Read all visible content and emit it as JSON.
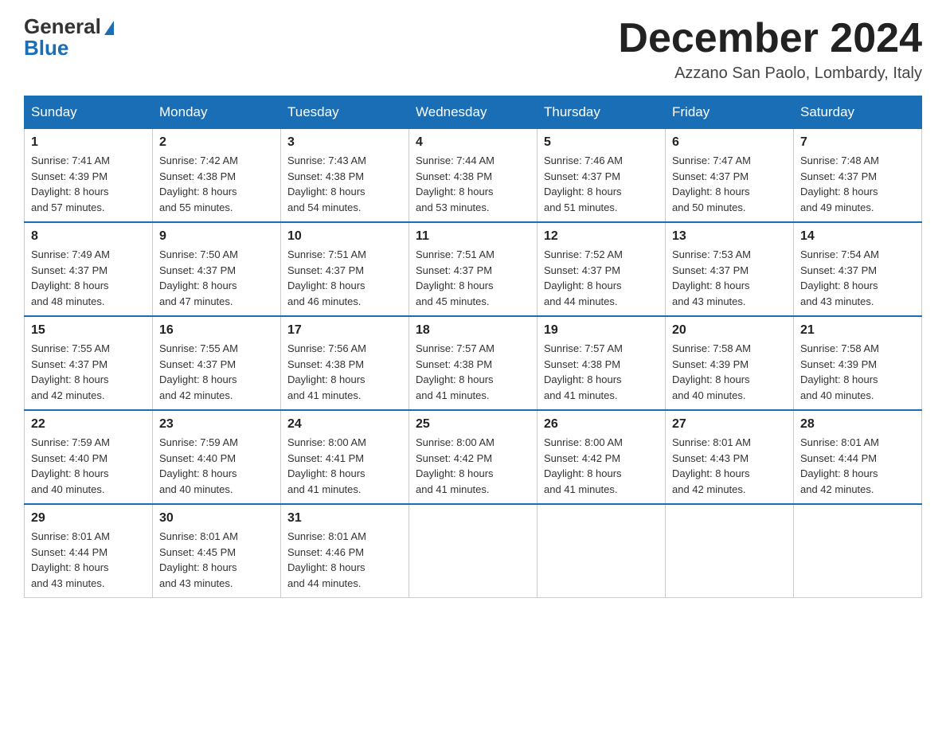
{
  "logo": {
    "general": "General",
    "blue": "Blue"
  },
  "title": "December 2024",
  "location": "Azzano San Paolo, Lombardy, Italy",
  "weekdays": [
    "Sunday",
    "Monday",
    "Tuesday",
    "Wednesday",
    "Thursday",
    "Friday",
    "Saturday"
  ],
  "weeks": [
    [
      {
        "day": "1",
        "sunrise": "7:41 AM",
        "sunset": "4:39 PM",
        "daylight": "8 hours and 57 minutes."
      },
      {
        "day": "2",
        "sunrise": "7:42 AM",
        "sunset": "4:38 PM",
        "daylight": "8 hours and 55 minutes."
      },
      {
        "day": "3",
        "sunrise": "7:43 AM",
        "sunset": "4:38 PM",
        "daylight": "8 hours and 54 minutes."
      },
      {
        "day": "4",
        "sunrise": "7:44 AM",
        "sunset": "4:38 PM",
        "daylight": "8 hours and 53 minutes."
      },
      {
        "day": "5",
        "sunrise": "7:46 AM",
        "sunset": "4:37 PM",
        "daylight": "8 hours and 51 minutes."
      },
      {
        "day": "6",
        "sunrise": "7:47 AM",
        "sunset": "4:37 PM",
        "daylight": "8 hours and 50 minutes."
      },
      {
        "day": "7",
        "sunrise": "7:48 AM",
        "sunset": "4:37 PM",
        "daylight": "8 hours and 49 minutes."
      }
    ],
    [
      {
        "day": "8",
        "sunrise": "7:49 AM",
        "sunset": "4:37 PM",
        "daylight": "8 hours and 48 minutes."
      },
      {
        "day": "9",
        "sunrise": "7:50 AM",
        "sunset": "4:37 PM",
        "daylight": "8 hours and 47 minutes."
      },
      {
        "day": "10",
        "sunrise": "7:51 AM",
        "sunset": "4:37 PM",
        "daylight": "8 hours and 46 minutes."
      },
      {
        "day": "11",
        "sunrise": "7:51 AM",
        "sunset": "4:37 PM",
        "daylight": "8 hours and 45 minutes."
      },
      {
        "day": "12",
        "sunrise": "7:52 AM",
        "sunset": "4:37 PM",
        "daylight": "8 hours and 44 minutes."
      },
      {
        "day": "13",
        "sunrise": "7:53 AM",
        "sunset": "4:37 PM",
        "daylight": "8 hours and 43 minutes."
      },
      {
        "day": "14",
        "sunrise": "7:54 AM",
        "sunset": "4:37 PM",
        "daylight": "8 hours and 43 minutes."
      }
    ],
    [
      {
        "day": "15",
        "sunrise": "7:55 AM",
        "sunset": "4:37 PM",
        "daylight": "8 hours and 42 minutes."
      },
      {
        "day": "16",
        "sunrise": "7:55 AM",
        "sunset": "4:37 PM",
        "daylight": "8 hours and 42 minutes."
      },
      {
        "day": "17",
        "sunrise": "7:56 AM",
        "sunset": "4:38 PM",
        "daylight": "8 hours and 41 minutes."
      },
      {
        "day": "18",
        "sunrise": "7:57 AM",
        "sunset": "4:38 PM",
        "daylight": "8 hours and 41 minutes."
      },
      {
        "day": "19",
        "sunrise": "7:57 AM",
        "sunset": "4:38 PM",
        "daylight": "8 hours and 41 minutes."
      },
      {
        "day": "20",
        "sunrise": "7:58 AM",
        "sunset": "4:39 PM",
        "daylight": "8 hours and 40 minutes."
      },
      {
        "day": "21",
        "sunrise": "7:58 AM",
        "sunset": "4:39 PM",
        "daylight": "8 hours and 40 minutes."
      }
    ],
    [
      {
        "day": "22",
        "sunrise": "7:59 AM",
        "sunset": "4:40 PM",
        "daylight": "8 hours and 40 minutes."
      },
      {
        "day": "23",
        "sunrise": "7:59 AM",
        "sunset": "4:40 PM",
        "daylight": "8 hours and 40 minutes."
      },
      {
        "day": "24",
        "sunrise": "8:00 AM",
        "sunset": "4:41 PM",
        "daylight": "8 hours and 41 minutes."
      },
      {
        "day": "25",
        "sunrise": "8:00 AM",
        "sunset": "4:42 PM",
        "daylight": "8 hours and 41 minutes."
      },
      {
        "day": "26",
        "sunrise": "8:00 AM",
        "sunset": "4:42 PM",
        "daylight": "8 hours and 41 minutes."
      },
      {
        "day": "27",
        "sunrise": "8:01 AM",
        "sunset": "4:43 PM",
        "daylight": "8 hours and 42 minutes."
      },
      {
        "day": "28",
        "sunrise": "8:01 AM",
        "sunset": "4:44 PM",
        "daylight": "8 hours and 42 minutes."
      }
    ],
    [
      {
        "day": "29",
        "sunrise": "8:01 AM",
        "sunset": "4:44 PM",
        "daylight": "8 hours and 43 minutes."
      },
      {
        "day": "30",
        "sunrise": "8:01 AM",
        "sunset": "4:45 PM",
        "daylight": "8 hours and 43 minutes."
      },
      {
        "day": "31",
        "sunrise": "8:01 AM",
        "sunset": "4:46 PM",
        "daylight": "8 hours and 44 minutes."
      },
      null,
      null,
      null,
      null
    ]
  ]
}
